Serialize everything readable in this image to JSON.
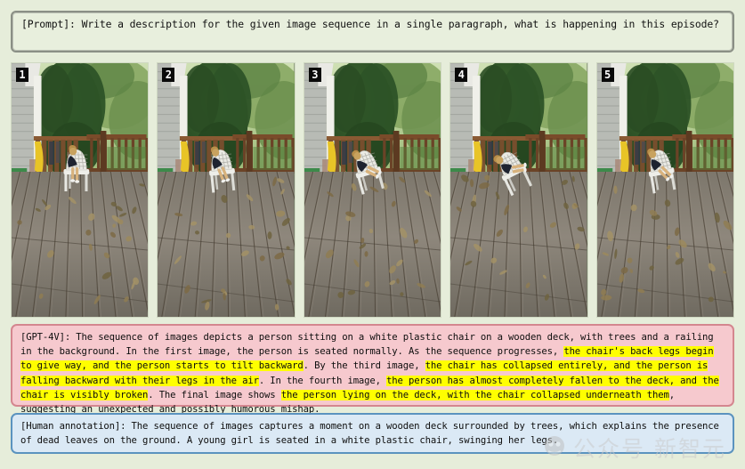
{
  "page": {
    "background_color": "#e6edda",
    "watermark_text": "公众号 新智元"
  },
  "prompt": {
    "label": "[Prompt]:",
    "text": "[Prompt]: Write a description for the given image sequence in a single paragraph, what is happening in this episode?",
    "border_color": "#8a8f85",
    "background_color": "#e8efdd"
  },
  "frames": [
    {
      "number": "1",
      "caption_hint": "person seated normally on white plastic chair on wooden deck"
    },
    {
      "number": "2",
      "caption_hint": "chair back legs begin to give way, person starts to tilt backward"
    },
    {
      "number": "3",
      "caption_hint": "chair collapsed, person falling backward with legs in the air"
    },
    {
      "number": "4",
      "caption_hint": "person almost completely fallen to the deck, chair visibly broken"
    },
    {
      "number": "5",
      "caption_hint": "person lying on the deck with the chair collapsed underneath"
    }
  ],
  "gpt_response": {
    "label": "[GPT-4V]:",
    "background_color": "#f6c9ce",
    "border_color": "#d4868f",
    "highlight_color": "#ffff00",
    "full_text": "[GPT-4V]: The sequence of images depicts a person sitting on a white plastic chair on a wooden deck, with trees and a railing in the background. In the first image, the person is seated normally. As the sequence progresses, the chair's back legs begin to give way, and the person starts to tilt backward. By the third image, the chair has collapsed entirely, and the person is falling backward with their legs in the air. In the fourth image, the person has almost completely fallen to the deck, and the chair is visibly broken. The final image shows the person lying on the deck, with the chair collapsed underneath them, suggesting an unexpected and possibly humorous mishap.",
    "segments": [
      {
        "text": "[GPT-4V]: The sequence of images depicts a person sitting on a white plastic chair on a wooden deck, with trees and a railing in the background. In the first image, the person is seated normally. As the sequence progresses, ",
        "highlight": false
      },
      {
        "text": "the chair's back legs begin to give way, and the person starts to tilt backward",
        "highlight": true
      },
      {
        "text": ". By the third image, ",
        "highlight": false
      },
      {
        "text": "the chair has collapsed entirely, and the person is falling backward with their legs in the air",
        "highlight": true
      },
      {
        "text": ". In the fourth image, ",
        "highlight": false
      },
      {
        "text": "the person has almost completely fallen to the deck, and the chair is visibly broken",
        "highlight": true
      },
      {
        "text": ". The final image shows ",
        "highlight": false
      },
      {
        "text": "the person lying on the deck, with the chair collapsed underneath them",
        "highlight": true
      },
      {
        "text": ", suggesting an unexpected and possibly humorous mishap.",
        "highlight": false
      }
    ]
  },
  "human_annotation": {
    "label": "[Human annotation]:",
    "background_color": "#dbe9f5",
    "border_color": "#5b93bf",
    "text": "[Human annotation]: The sequence of images captures a moment on a wooden deck surrounded by trees, which explains the presence of dead leaves on the ground. A young girl is seated in a white plastic chair, swinging her legs."
  }
}
